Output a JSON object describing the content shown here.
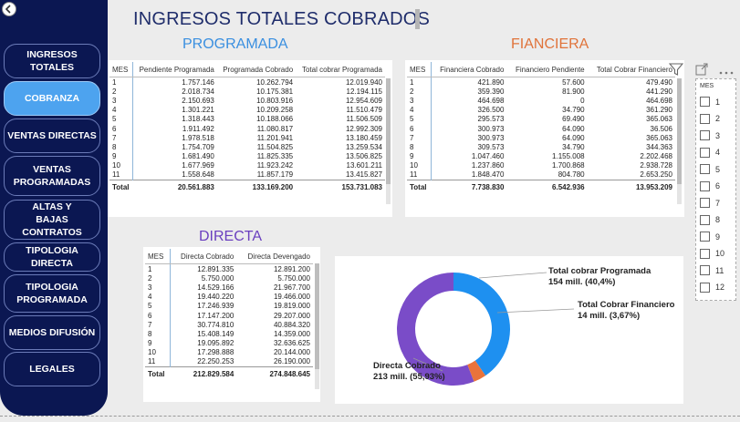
{
  "sidebar": {
    "items": [
      {
        "label": "INGRESOS TOTALES",
        "active": false
      },
      {
        "label": "COBRANZA",
        "active": true
      },
      {
        "label": "VENTAS DIRECTAS",
        "active": false
      },
      {
        "label": "VENTAS PROGRAMADAS",
        "active": false
      },
      {
        "label": "ALTAS Y BAJAS CONTRATOS",
        "active": false
      },
      {
        "label": "TIPOLOGIA DIRECTA",
        "active": false
      },
      {
        "label": "TIPOLOGIA PROGRAMADA",
        "active": false
      },
      {
        "label": "MEDIOS DIFUSIÓN",
        "active": false
      },
      {
        "label": "LEGALES",
        "active": false
      }
    ]
  },
  "page": {
    "title": "INGRESOS TOTALES COBRADOS"
  },
  "programada": {
    "title": "PROGRAMADA",
    "title_color": "#3a8fe0",
    "headers": [
      "MES",
      "Pendiente Programada",
      "Programada Cobrado",
      "Total cobrar Programada"
    ],
    "rows": [
      [
        "1",
        "1.757.146",
        "10.262.794",
        "12.019.940"
      ],
      [
        "2",
        "2.018.734",
        "10.175.381",
        "12.194.115"
      ],
      [
        "3",
        "2.150.693",
        "10.803.916",
        "12.954.609"
      ],
      [
        "4",
        "1.301.221",
        "10.209.258",
        "11.510.479"
      ],
      [
        "5",
        "1.318.443",
        "10.188.066",
        "11.506.509"
      ],
      [
        "6",
        "1.911.492",
        "11.080.817",
        "12.992.309"
      ],
      [
        "7",
        "1.978.518",
        "11.201.941",
        "13.180.459"
      ],
      [
        "8",
        "1.754.709",
        "11.504.825",
        "13.259.534"
      ],
      [
        "9",
        "1.681.490",
        "11.825.335",
        "13.506.825"
      ],
      [
        "10",
        "1.677.969",
        "11.923.242",
        "13.601.211"
      ],
      [
        "11",
        "1.558.648",
        "11.857.179",
        "13.415.827"
      ]
    ],
    "total": [
      "Total",
      "20.561.883",
      "133.169.200",
      "153.731.083"
    ]
  },
  "financiera": {
    "title": "FIANCIERA",
    "title_color": "#e0733a",
    "headers": [
      "MES",
      "Financiera Cobrado",
      "Financiero Pendiente",
      "Total Cobrar Financiero"
    ],
    "rows": [
      [
        "1",
        "421.890",
        "57.600",
        "479.490"
      ],
      [
        "2",
        "359.390",
        "81.900",
        "441.290"
      ],
      [
        "3",
        "464.698",
        "0",
        "464.698"
      ],
      [
        "4",
        "326.500",
        "34.790",
        "361.290"
      ],
      [
        "5",
        "295.573",
        "69.490",
        "365.063"
      ],
      [
        "6",
        "300.973",
        "64.090",
        "36.506"
      ],
      [
        "7",
        "300.973",
        "64.090",
        "365.063"
      ],
      [
        "8",
        "309.573",
        "34.790",
        "344.363"
      ],
      [
        "9",
        "1.047.460",
        "1.155.008",
        "2.202.468"
      ],
      [
        "10",
        "1.237.860",
        "1.700.868",
        "2.938.728"
      ],
      [
        "11",
        "1.848.470",
        "804.780",
        "2.653.250"
      ]
    ],
    "total": [
      "Total",
      "7.738.830",
      "6.542.936",
      "13.953.209"
    ]
  },
  "directa": {
    "title": "DIRECTA",
    "title_color": "#6a3fbf",
    "headers": [
      "MES",
      "Directa Cobrado",
      "Directa Devengado"
    ],
    "rows": [
      [
        "1",
        "12.891.335",
        "12.891.200"
      ],
      [
        "2",
        "5.750.000",
        "5.750.000"
      ],
      [
        "3",
        "14.529.166",
        "21.967.700"
      ],
      [
        "4",
        "19.440.220",
        "19.466.000"
      ],
      [
        "5",
        "17.246.939",
        "19.819.000"
      ],
      [
        "6",
        "17.147.200",
        "29.207.000"
      ],
      [
        "7",
        "30.774.810",
        "40.884.320"
      ],
      [
        "8",
        "15.408.149",
        "14.359.000"
      ],
      [
        "9",
        "19.095.892",
        "32.636.625"
      ],
      [
        "10",
        "17.298.888",
        "20.144.000"
      ],
      [
        "11",
        "22.250.253",
        "26.190.000"
      ]
    ],
    "total": [
      "Total",
      "212.829.584",
      "274.848.645"
    ]
  },
  "slicer": {
    "title": "MES",
    "items": [
      "1",
      "2",
      "3",
      "4",
      "5",
      "6",
      "7",
      "8",
      "9",
      "10",
      "11",
      "12"
    ]
  },
  "chart_data": {
    "type": "pie",
    "donut": true,
    "slices": [
      {
        "name": "Total cobrar Programada",
        "value": 154,
        "label": "154 mill. (40,4%)",
        "color": "#1e90f0"
      },
      {
        "name": "Total Cobrar Financiero",
        "value": 14,
        "label": "14 mill. (3,67%)",
        "color": "#e9733b"
      },
      {
        "name": "Directa Cobrado",
        "value": 213,
        "label": "213 mill. (55,93%)",
        "color": "#7a4cc8"
      }
    ]
  }
}
